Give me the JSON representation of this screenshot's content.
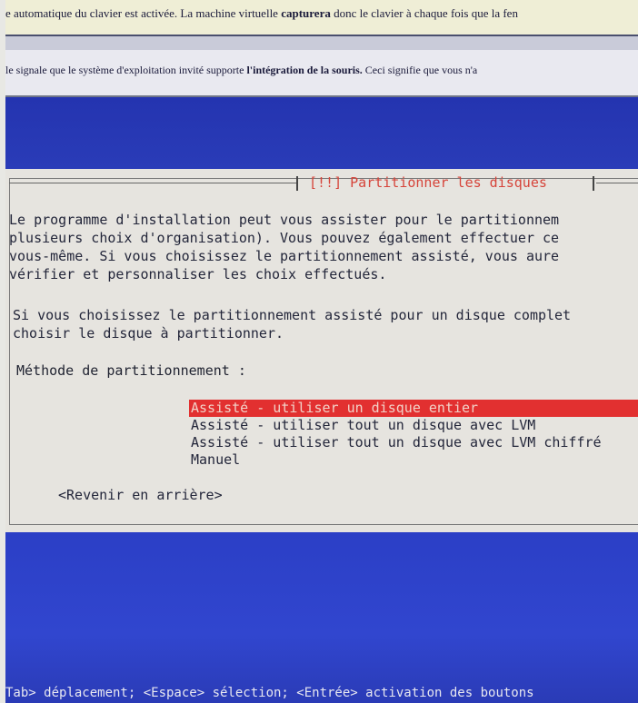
{
  "vm_notices": {
    "keyboard_capture": "e automatique du clavier est activée. La machine virtuelle capturera donc le clavier à chaque fois que la fen",
    "mouse_integration": "le signale que le système d'exploitation invité supporte l'intégration de la souris. Ceci signifie que vous n'a"
  },
  "dialog": {
    "title": "[!!] Partitionner les disques",
    "paragraph1": "Le programme d'installation peut vous assister pour le partitionnem\nplusieurs choix d'organisation). Vous pouvez également effectuer ce\nvous-même. Si vous choisissez le partitionnement assisté, vous aure\nvérifier et personnaliser les choix effectués.",
    "paragraph2": "Si vous choisissez le partitionnement assisté pour un disque complet\nchoisir le disque à partitionner.",
    "method_label": "Méthode de partitionnement :",
    "options": [
      "Assisté - utiliser un disque entier",
      "Assisté - utiliser tout un disque avec LVM",
      "Assisté - utiliser tout un disque avec LVM chiffré",
      "Manuel"
    ],
    "selected_option_index": 0,
    "back_button": "<Revenir en arrière>"
  },
  "help_bar": "Tab> déplacement; <Espace> sélection; <Entrée> activation des boutons",
  "colors": {
    "background_blue": "#2a3bb4",
    "dialog_bg": "#e6e4df",
    "title_red": "#d6443a",
    "selection_red": "#e23030"
  }
}
